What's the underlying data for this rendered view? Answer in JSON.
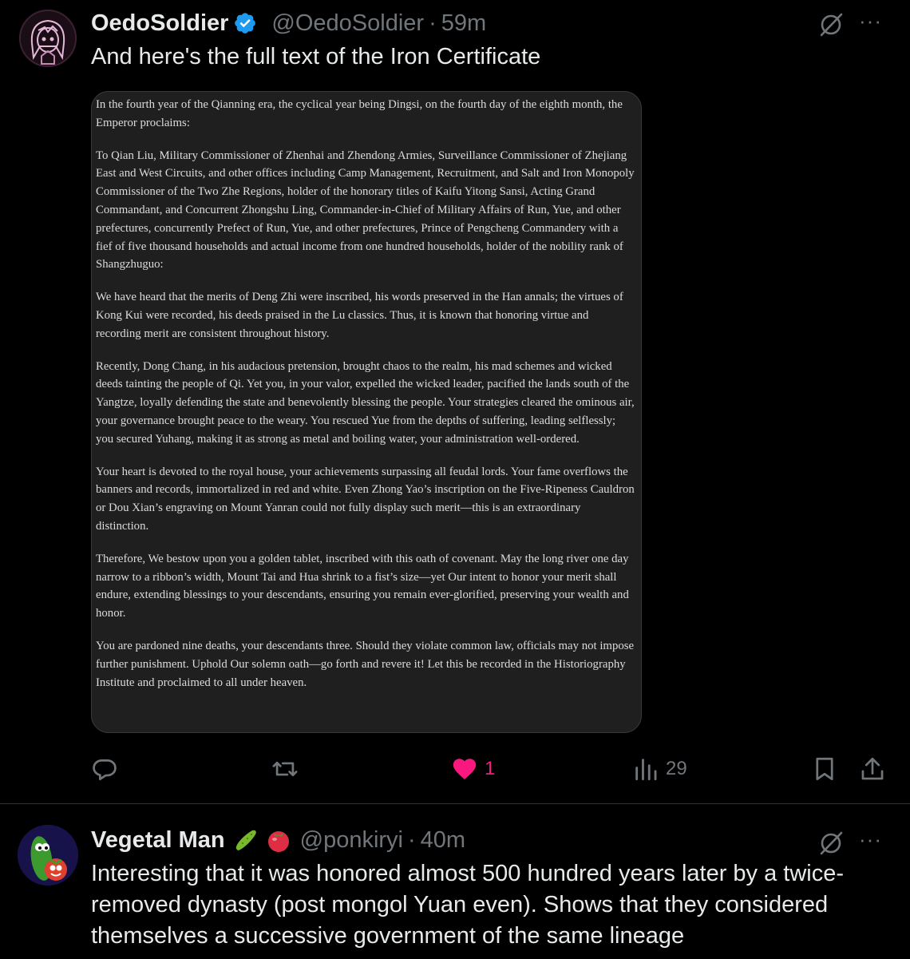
{
  "tweets": [
    {
      "display_name": "OedoSoldier",
      "handle": "@OedoSoldier",
      "separator": "·",
      "time": "59m",
      "verified": true,
      "text": "And here's the full text of the Iron Certificate",
      "attachment_paragraphs": [
        "In the fourth year of the Qianning era, the cyclical year being Dingsi, on the fourth day of the eighth month, the Emperor proclaims:",
        "To Qian Liu, Military Commissioner of Zhenhai and Zhendong Armies, Surveillance Commissioner of Zhejiang East and West Circuits, and other offices including Camp Management, Recruitment, and Salt and Iron Monopoly Commissioner of the Two Zhe Regions, holder of the honorary titles of Kaifu Yitong Sansi, Acting Grand Commandant, and Concurrent Zhongshu Ling, Commander-in-Chief of Military Affairs of Run, Yue, and other prefectures, concurrently Prefect of Run, Yue, and other prefectures, Prince of Pengcheng Commandery with a fief of five thousand households and actual income from one hundred households, holder of the nobility rank of Shangzhuguo:",
        "We have heard that the merits of Deng Zhi were inscribed, his words preserved in the Han annals; the virtues of Kong Kui were recorded, his deeds praised in the Lu classics. Thus, it is known that honoring virtue and recording merit are consistent throughout history.",
        "Recently, Dong Chang, in his audacious pretension, brought chaos to the realm, his mad schemes and wicked deeds tainting the people of Qi. Yet you, in your valor, expelled the wicked leader, pacified the lands south of the Yangtze, loyally defending the state and benevolently blessing the people. Your strategies cleared the ominous air, your governance brought peace to the weary. You rescued Yue from the depths of suffering, leading selflessly; you secured Yuhang, making it as strong as metal and boiling water, your administration well-ordered.",
        "Your heart is devoted to the royal house, your achievements surpassing all feudal lords. Your fame overflows the banners and records, immortalized in red and white. Even Zhong Yao’s inscription on the Five-Ripeness Cauldron or Dou Xian’s engraving on Mount Yanran could not fully display such merit—this is an extraordinary distinction.",
        "Therefore, We bestow upon you a golden tablet, inscribed with this oath of covenant. May the long river one day narrow to a ribbon’s width, Mount Tai and Hua shrink to a fist’s size—yet Our intent to honor your merit shall endure, extending blessings to your descendants, ensuring you remain ever-glorified, preserving your wealth and honor.",
        "You are pardoned nine deaths, your descendants three. Should they violate common law, officials may not impose further punishment. Uphold Our solemn oath—go forth and revere it! Let this be recorded in the Historiography Institute and proclaimed to all under heaven."
      ],
      "actions": {
        "reply_count": "",
        "retweet_count": "",
        "like_count": "1",
        "view_count": "29"
      }
    },
    {
      "display_name": "Vegetal Man",
      "emojis": [
        "cucumber-icon",
        "tomato-icon"
      ],
      "handle": "@ponkiryi",
      "separator": "·",
      "time": "40m",
      "text": "Interesting that it was honored almost 500 hundred years later by a twice-removed dynasty (post mongol Yuan even). Shows that they considered themselves a successive government of the same lineage"
    }
  ],
  "more_glyph": "···",
  "colors": {
    "background": "#000000",
    "text": "#e7e9ea",
    "secondary": "#71767b",
    "like": "#f91880",
    "verified": "#1d9bf0",
    "divider": "#2f3336"
  },
  "icons": [
    "grok-icon",
    "more-icon",
    "reply-icon",
    "retweet-icon",
    "heart-icon",
    "views-icon",
    "bookmark-icon",
    "share-icon",
    "verified-badge-icon"
  ]
}
